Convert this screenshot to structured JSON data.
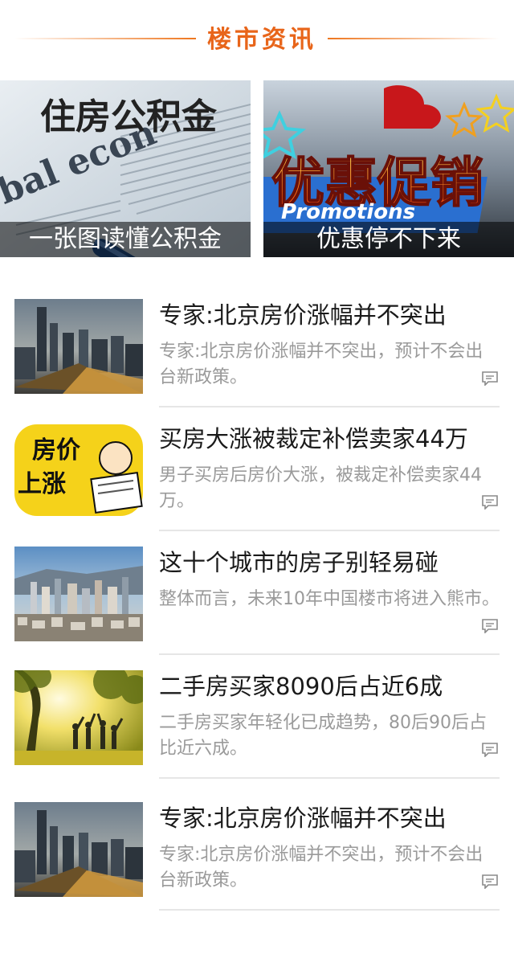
{
  "header": {
    "title": "楼市资讯"
  },
  "banners": [
    {
      "caption": "一张图读懂公积金",
      "image_text": "住房公积金",
      "image_sub": "bal econ"
    },
    {
      "caption": "优惠停不下来",
      "image_text": "优惠促销",
      "image_sub": "Promotions"
    }
  ],
  "news": [
    {
      "title": "专家:北京房价涨幅并不突出",
      "summary": "专家:北京房价涨幅并不突出，预计不会出台新政策。",
      "thumb": "city-night"
    },
    {
      "title": "买房大涨被裁定补偿卖家44万",
      "summary": "男子买房后房价大涨，被裁定补偿卖家44万。",
      "thumb": "price-up",
      "thumb_text_1": "房价",
      "thumb_text_2": "上涨"
    },
    {
      "title": "这十个城市的房子别轻易碰",
      "summary": "整体而言，未来10年中国楼市将进入熊市。",
      "thumb": "city-day"
    },
    {
      "title": "二手房买家8090后占近6成",
      "summary": "二手房买家年轻化已成趋势，80后90后占比近六成。",
      "thumb": "people-sunset"
    },
    {
      "title": "专家:北京房价涨幅并不突出",
      "summary": "专家:北京房价涨幅并不突出，预计不会出台新政策。",
      "thumb": "city-night"
    }
  ],
  "colors": {
    "accent": "#e8651a",
    "title_text": "#1a1a1a",
    "summary_text": "#9a9a9a"
  }
}
